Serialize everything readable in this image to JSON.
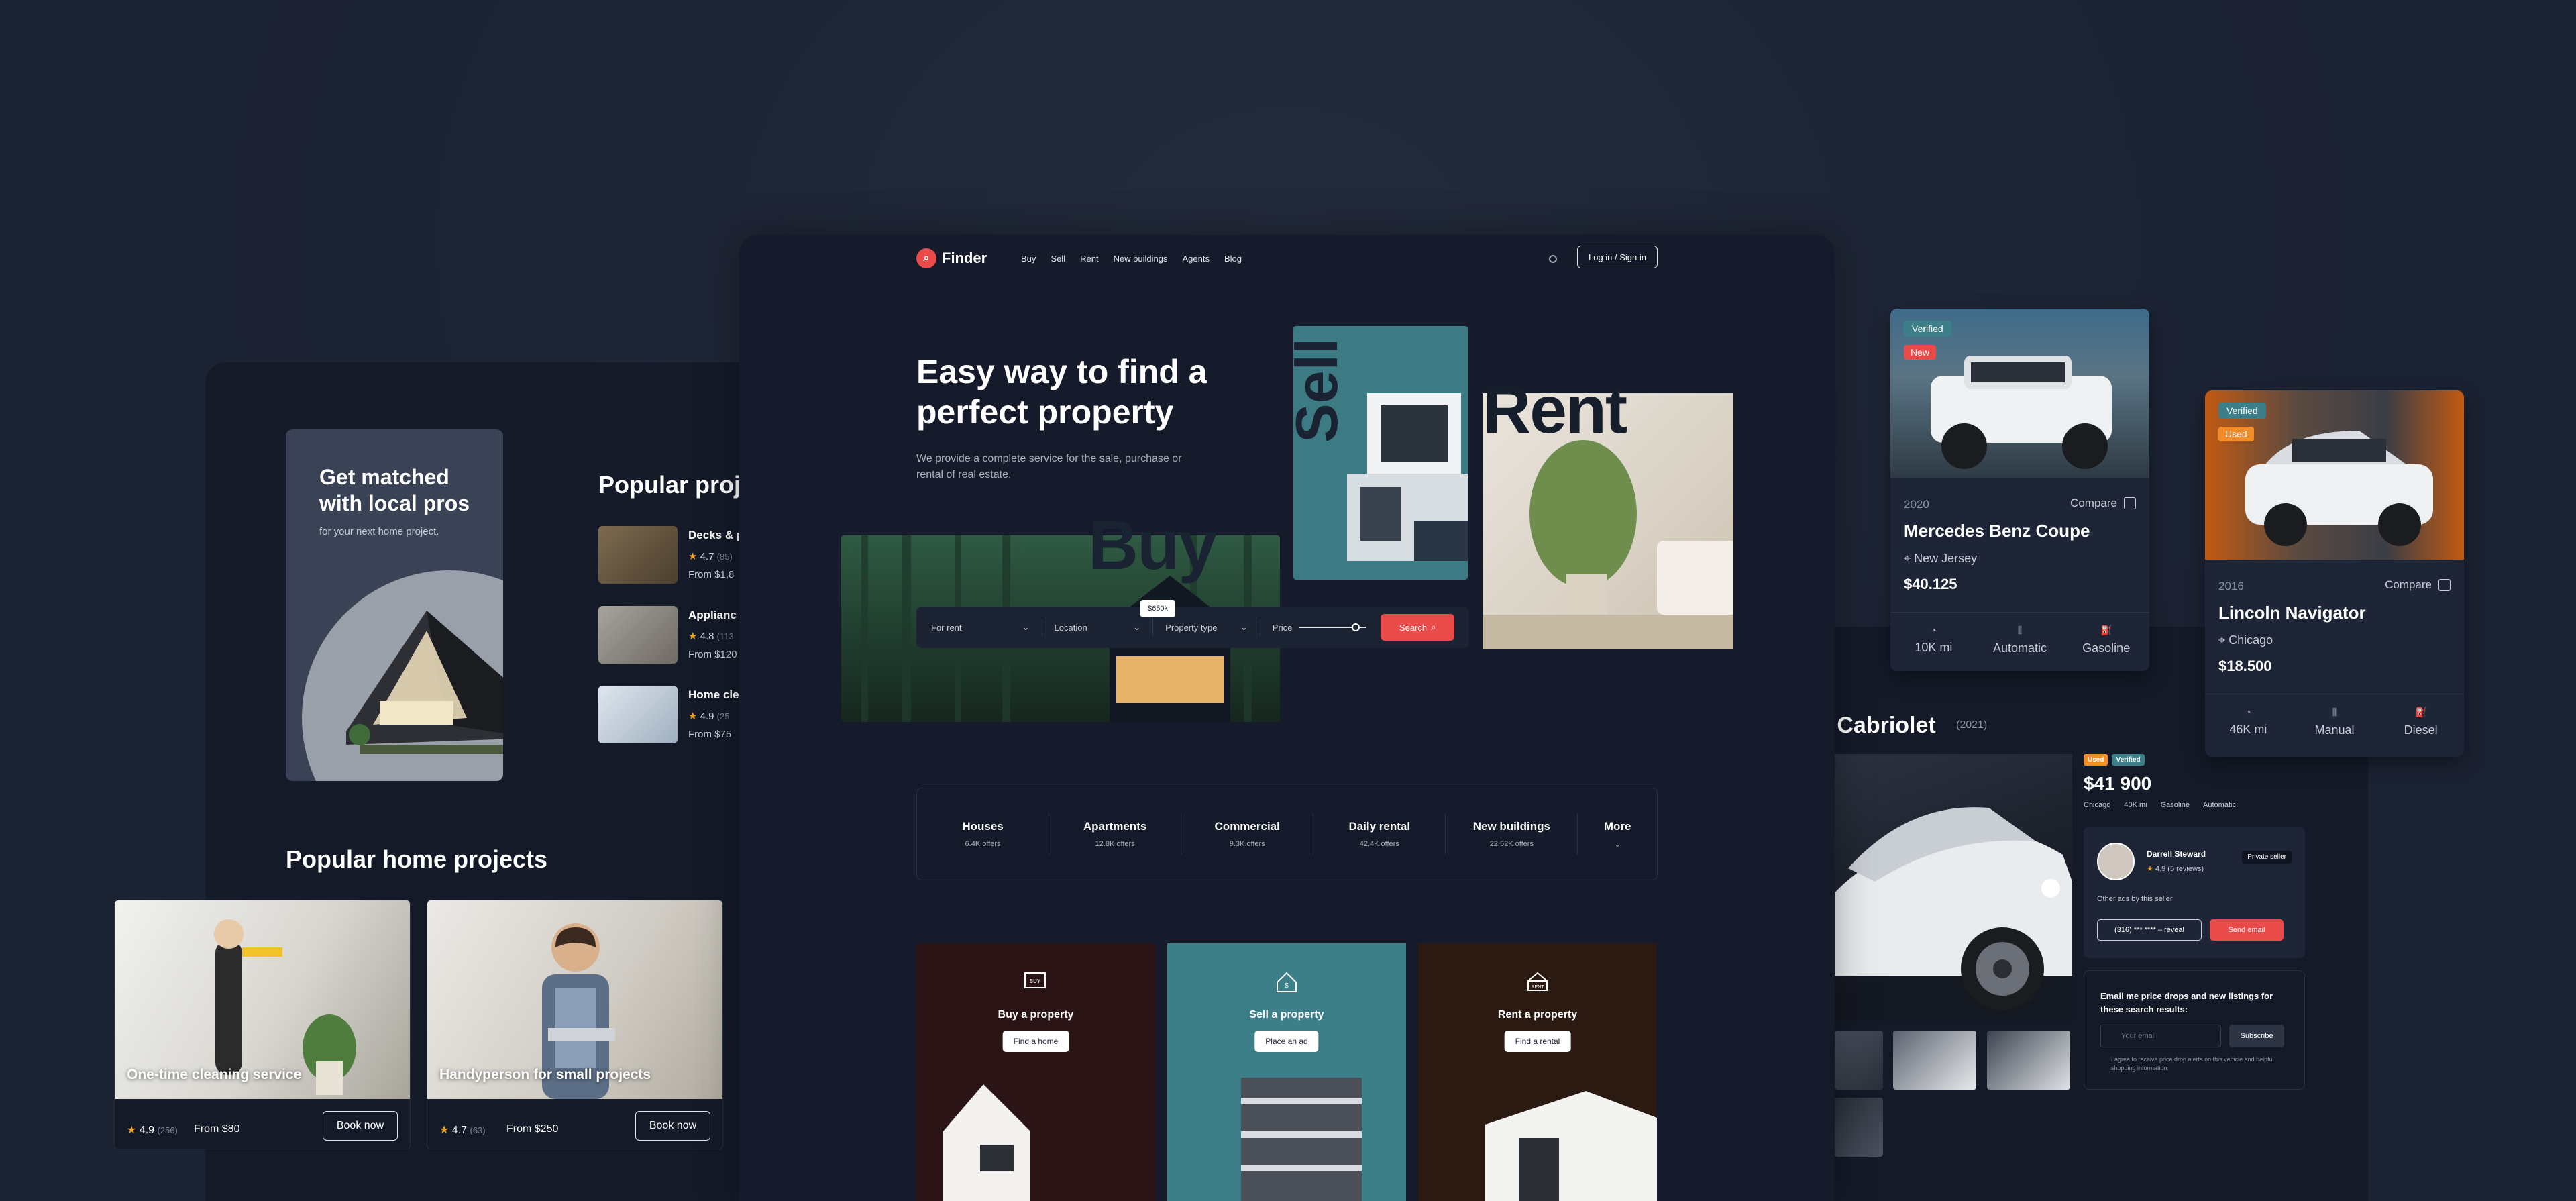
{
  "left": {
    "promo_title": "Get matched with local pros",
    "promo_sub": "for your next home project.",
    "popular_title": "Popular proje",
    "projects": [
      {
        "name": "Decks & p",
        "rating": "4.7",
        "reviews": "(85)",
        "price": "From $1,8"
      },
      {
        "name": "Applianc",
        "rating": "4.8",
        "reviews": "(113",
        "price": "From $120"
      },
      {
        "name": "Home cle",
        "rating": "4.9",
        "reviews": "(25",
        "price": "From $75"
      }
    ],
    "home_projects_title": "Popular home projects",
    "cards": [
      {
        "caption": "One-time cleaning service",
        "rating": "4.9",
        "reviews": "(256)",
        "price": "From $80",
        "button": "Book now"
      },
      {
        "caption": "Handyperson for small projects",
        "rating": "4.7",
        "reviews": "(63)",
        "price": "From $250",
        "button": "Book now"
      }
    ]
  },
  "main": {
    "logo": "Finder",
    "nav": [
      "Buy",
      "Sell",
      "Rent",
      "New buildings",
      "Agents",
      "Blog"
    ],
    "login": "Log in / Sign in",
    "hero_title": "Easy way to find a perfect property",
    "hero_sub": "We provide a complete service for the sale, purchase or rental of real estate.",
    "words": {
      "buy": "Buy",
      "sell": "Sell",
      "rent": "Rent"
    },
    "search": {
      "rent": "For rent",
      "location": "Location",
      "type": "Property type",
      "price": "Price",
      "price_tip": "$650k",
      "button": "Search",
      "price_level": 0.85
    },
    "categories": [
      {
        "title": "Houses",
        "sub": "6.4K offers"
      },
      {
        "title": "Apartments",
        "sub": "12.8K offers"
      },
      {
        "title": "Commercial",
        "sub": "9.3K offers"
      },
      {
        "title": "Daily rental",
        "sub": "42.4K offers"
      },
      {
        "title": "New buildings",
        "sub": "22.52K offers"
      },
      {
        "title": "More",
        "sub": ""
      }
    ],
    "actions": [
      {
        "title": "Buy a property",
        "button": "Find a home",
        "icon_text": "BUY",
        "color": "#2a1416"
      },
      {
        "title": "Sell a property",
        "button": "Place an ad",
        "icon_text": "$",
        "color": "#3d7f88"
      },
      {
        "title": "Rent a property",
        "button": "Find a rental",
        "icon_text": "RENT",
        "color": "#2a1a12"
      }
    ]
  },
  "car_detail": {
    "title": "s Cabriolet",
    "year": "(2021)",
    "badges": [
      "Used",
      "Verified"
    ],
    "price": "$41 900",
    "specs": [
      "Chicago",
      "40K mi",
      "Gasoline",
      "Automatic"
    ],
    "seller_name": "Darrell Steward",
    "seller_rating": "4.9",
    "seller_reviews": "(5 reviews)",
    "seller_type": "Private seller",
    "other_ads": "Other ads by this seller",
    "phone": "(316) *** **** – reveal",
    "send_email": "Send email",
    "email_title": "Email me price drops and new listings for these search results:",
    "email_placeholder": "Your email",
    "subscribe": "Subscribe",
    "consent": "I agree to receive price drop alerts on this vehicle and helpful shopping information."
  },
  "car_cards": [
    {
      "verified": "Verified",
      "status": "New",
      "status_color": "#e94a4a",
      "year": "2020",
      "compare": "Compare",
      "name": "Mercedes Benz Coupe",
      "location": "New Jersey",
      "price": "$40.125",
      "specs": [
        "10K mi",
        "Automatic",
        "Gasoline"
      ]
    },
    {
      "verified": "Verified",
      "status": "Used",
      "status_color": "#f08c2a",
      "year": "2016",
      "compare": "Compare",
      "name": "Lincoln Navigator",
      "location": "Chicago",
      "price": "$18.500",
      "specs": [
        "46K mi",
        "Manual",
        "Diesel"
      ]
    }
  ]
}
